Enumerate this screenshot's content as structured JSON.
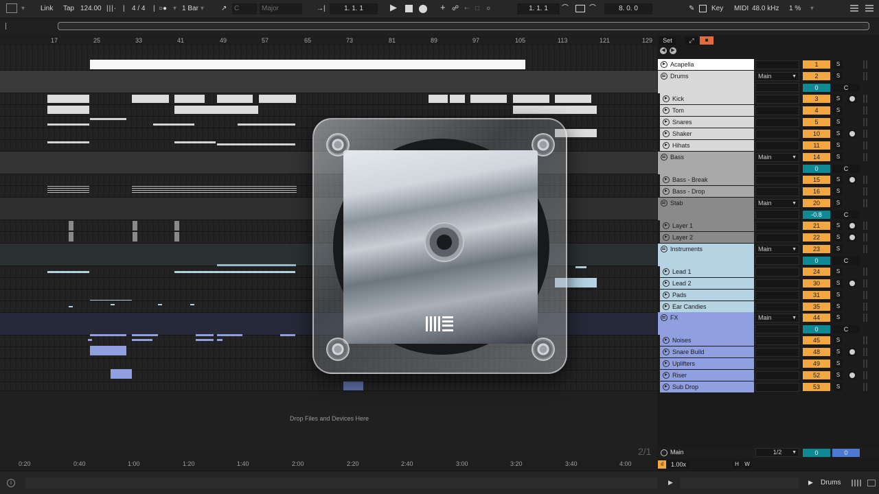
{
  "toolbar": {
    "link_label": "Link",
    "tap_label": "Tap",
    "tempo": "124.00",
    "time_signature": "4 / 4",
    "metronome_label": "●",
    "quantize": "1 Bar",
    "key_root": "C",
    "scale": "Major",
    "arrangement_position": "1.   1.   1",
    "loop_start": "1.   1.   1",
    "loop_length": "8.   0.   0",
    "key_label": "Key",
    "midi_label": "MIDI",
    "sample_rate": "48.0 kHz",
    "cpu": "1 %"
  },
  "ruler": {
    "bars": [
      "17",
      "25",
      "33",
      "41",
      "49",
      "57",
      "65",
      "73",
      "81",
      "89",
      "97",
      "105",
      "113",
      "121",
      "129"
    ]
  },
  "set_panel": {
    "set_label": "Set"
  },
  "tracks": [
    {
      "name": "Acapella",
      "type": "audio",
      "color": "#ffffff",
      "number": "1"
    },
    {
      "name": "Drums",
      "type": "group",
      "color": "#d8d8d8",
      "number": "2",
      "output": "Main",
      "volume": "0",
      "pan": "C"
    },
    {
      "name": "Kick",
      "type": "audio",
      "color": "#d8d8d8",
      "number": "3"
    },
    {
      "name": "Tom",
      "type": "audio",
      "color": "#d8d8d8",
      "number": "4"
    },
    {
      "name": "Snares",
      "type": "audio",
      "color": "#d8d8d8",
      "number": "5"
    },
    {
      "name": "Shaker",
      "type": "audio",
      "color": "#d8d8d8",
      "number": "10"
    },
    {
      "name": "Hihats",
      "type": "audio",
      "color": "#d8d8d8",
      "number": "11"
    },
    {
      "name": "Bass",
      "type": "group",
      "color": "#a8a8a8",
      "number": "14",
      "output": "Main",
      "volume": "0",
      "pan": "C"
    },
    {
      "name": "Bass - Break",
      "type": "audio",
      "color": "#a8a8a8",
      "number": "15"
    },
    {
      "name": "Bass - Drop",
      "type": "audio",
      "color": "#a8a8a8",
      "number": "16"
    },
    {
      "name": "Stab",
      "type": "group",
      "color": "#8a8a8a",
      "number": "20",
      "output": "Main",
      "volume": "-0.8",
      "pan": "C"
    },
    {
      "name": "Layer 1",
      "type": "audio",
      "color": "#8a8a8a",
      "number": "21"
    },
    {
      "name": "Layer 2",
      "type": "audio",
      "color": "#8a8a8a",
      "number": "22"
    },
    {
      "name": "Instruments",
      "type": "group",
      "color": "#b5d3e3",
      "number": "23",
      "output": "Main",
      "volume": "0",
      "pan": "C"
    },
    {
      "name": "Lead 1",
      "type": "audio",
      "color": "#b5d3e3",
      "number": "24"
    },
    {
      "name": "Lead 2",
      "type": "audio",
      "color": "#b5d3e3",
      "number": "30"
    },
    {
      "name": "Pads",
      "type": "audio",
      "color": "#b5d3e3",
      "number": "31"
    },
    {
      "name": "Ear Candies",
      "type": "audio",
      "color": "#b5d3e3",
      "number": "35"
    },
    {
      "name": "FX",
      "type": "group",
      "color": "#8f9fe0",
      "number": "44",
      "output": "Main",
      "volume": "0",
      "pan": "C"
    },
    {
      "name": "Noises",
      "type": "audio",
      "color": "#8f9fe0",
      "number": "45"
    },
    {
      "name": "Snare Build",
      "type": "audio",
      "color": "#8f9fe0",
      "number": "48"
    },
    {
      "name": "Uplifters",
      "type": "audio",
      "color": "#8f9fe0",
      "number": "49"
    },
    {
      "name": "Riser",
      "type": "audio",
      "color": "#8f9fe0",
      "number": "52"
    },
    {
      "name": "Sub Drop",
      "type": "audio",
      "color": "#8f9fe0",
      "number": "53"
    }
  ],
  "solo_label": "S",
  "arrangement": {
    "drop_hint": "Drop Files and Devices Here",
    "page_indicator": "2/1"
  },
  "main_track": {
    "name": "Main",
    "routing": "1/2",
    "volume": "0",
    "pan": "0",
    "zoom": "1.00x",
    "h_label": "H",
    "w_label": "W"
  },
  "time_axis": [
    "0:20",
    "0:40",
    "1:00",
    "1:20",
    "1:40",
    "2:00",
    "2:20",
    "2:40",
    "3:00",
    "3:20",
    "3:40",
    "4:00"
  ],
  "statusbar": {
    "selected_track": "Drums"
  },
  "colors": {
    "number_orange": "#f3a743",
    "volume_teal": "#0f8a94",
    "pan_blue": "#4a7bd0"
  }
}
